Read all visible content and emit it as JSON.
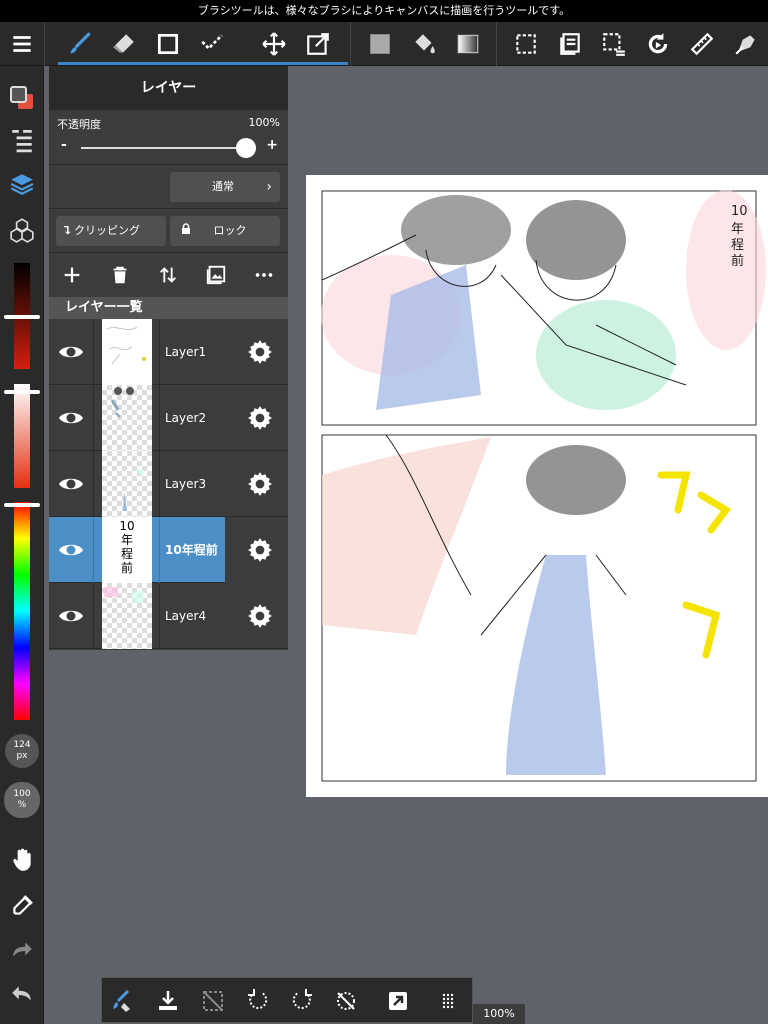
{
  "tooltip": "ブラシツールは、様々なブラシによりキャンバスに描画を行うツールです。",
  "layer_panel": {
    "title": "レイヤー",
    "opacity_label": "不透明度",
    "opacity_value": "100%",
    "opacity_fraction": 1.0,
    "minus": "-",
    "plus": "+",
    "blend_mode": "通常",
    "clipping_label": "クリッピング",
    "lock_label": "ロック",
    "list_title": "レイヤー一覧",
    "layers": [
      {
        "name": "Layer1",
        "selected": false
      },
      {
        "name": "Layer2",
        "selected": false
      },
      {
        "name": "Layer3",
        "selected": false
      },
      {
        "name": "10年程前",
        "selected": true,
        "thumb_text": [
          "10",
          "年",
          "程",
          "前"
        ]
      },
      {
        "name": "Layer4",
        "selected": false
      }
    ]
  },
  "sidebar": {
    "brush_size": "124",
    "brush_size_unit": "px",
    "brush_opacity": "100",
    "brush_opacity_unit": "%"
  },
  "zoom": "100%",
  "colors": {
    "accent": "#3a86c8",
    "selected_layer": "#4c8fc7",
    "panel": "#3c3c3c",
    "toolbar": "#2a2a2a",
    "canvas_bg": "#5f6369",
    "main_color": "#e0503c"
  }
}
